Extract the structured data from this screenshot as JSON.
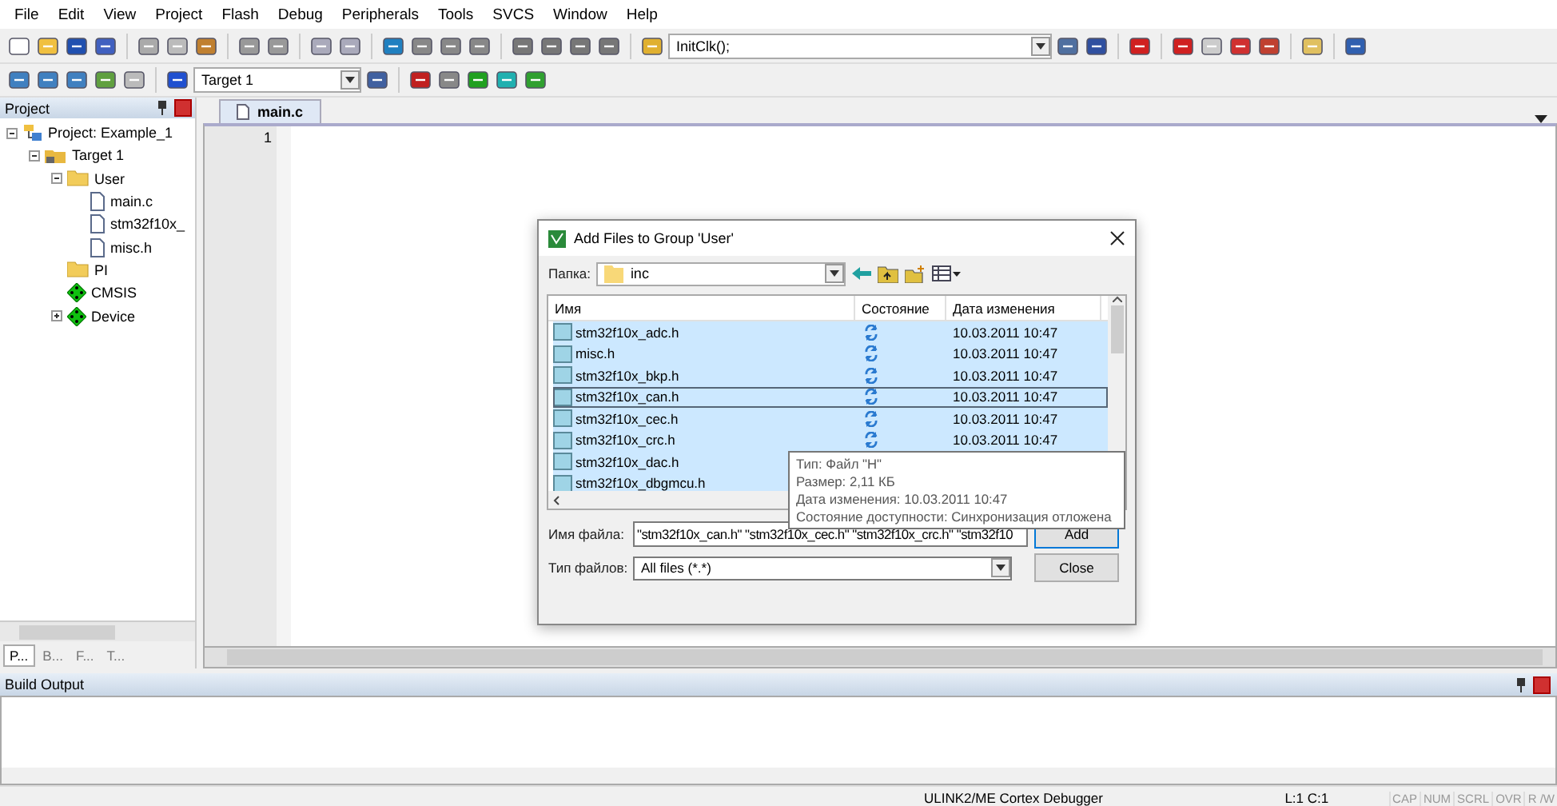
{
  "menu": [
    "File",
    "Edit",
    "View",
    "Project",
    "Flash",
    "Debug",
    "Peripherals",
    "Tools",
    "SVCS",
    "Window",
    "Help"
  ],
  "toolbar": {
    "function_combo": "InitClk();",
    "target_combo": "Target 1"
  },
  "project_panel": {
    "title": "Project",
    "tree": [
      {
        "label": "Project: Example_1",
        "kind": "project",
        "expanded": true,
        "children": [
          {
            "label": "Target 1",
            "kind": "target",
            "expanded": true,
            "children": [
              {
                "label": "User",
                "kind": "folder",
                "expanded": true,
                "children": [
                  {
                    "label": "main.c",
                    "kind": "file"
                  },
                  {
                    "label": "stm32f10x_",
                    "kind": "file"
                  },
                  {
                    "label": "misc.h",
                    "kind": "file"
                  }
                ]
              },
              {
                "label": "PI",
                "kind": "folder"
              },
              {
                "label": "CMSIS",
                "kind": "component"
              },
              {
                "label": "Device",
                "kind": "component",
                "expanded": false
              }
            ]
          }
        ]
      }
    ],
    "tabs": [
      {
        "label": "P...",
        "selected": true
      },
      {
        "label": "B...",
        "selected": false
      },
      {
        "label": "F...",
        "selected": false
      },
      {
        "label": "T...",
        "selected": false
      }
    ]
  },
  "editor": {
    "tab": "main.c",
    "line_numbers": [
      "1"
    ]
  },
  "dialog": {
    "title": "Add Files to Group 'User'",
    "folder_label": "Папка:",
    "folder": "inc",
    "columns": [
      "Имя",
      "Состояние",
      "Дата изменения"
    ],
    "rows": [
      {
        "name": "stm32f10x_adc.h",
        "sync_pending": true,
        "date": "10.03.2011 10:47",
        "selected": true,
        "focused": false
      },
      {
        "name": "misc.h",
        "sync_pending": true,
        "date": "10.03.2011 10:47",
        "selected": true,
        "focused": false
      },
      {
        "name": "stm32f10x_bkp.h",
        "sync_pending": true,
        "date": "10.03.2011 10:47",
        "selected": true,
        "focused": false
      },
      {
        "name": "stm32f10x_can.h",
        "sync_pending": true,
        "date": "10.03.2011 10:47",
        "selected": true,
        "focused": true
      },
      {
        "name": "stm32f10x_cec.h",
        "sync_pending": true,
        "date": "10.03.2011 10:47",
        "selected": true,
        "focused": false
      },
      {
        "name": "stm32f10x_crc.h",
        "sync_pending": true,
        "date": "10.03.2011 10:47",
        "selected": true,
        "focused": false
      },
      {
        "name": "stm32f10x_dac.h",
        "selected": true,
        "focused": false
      },
      {
        "name": "stm32f10x_dbgmcu.h",
        "selected": true,
        "focused": false
      }
    ],
    "tooltip": [
      "Тип: Файл \"H\"",
      "Размер: 2,11 КБ",
      "Дата изменения: 10.03.2011 10:47",
      "Состояние доступности: Синхронизация отложена"
    ],
    "filename_label": "Имя файла:",
    "filename": "\"stm32f10x_can.h\" \"stm32f10x_cec.h\" \"stm32f10x_crc.h\" \"stm32f10",
    "filetype_label": "Тип файлов:",
    "filetype": "All files (*.*)",
    "buttons": [
      "Add",
      "Close"
    ]
  },
  "build_output": {
    "title": "Build Output"
  },
  "status_bar": {
    "debugger": "ULINK2/ME Cortex Debugger",
    "position": "L:1 C:1",
    "indicators": [
      {
        "label": "CAP",
        "on": false
      },
      {
        "label": "NUM",
        "on": false
      },
      {
        "label": "SCRL",
        "on": false
      },
      {
        "label": "OVR",
        "on": false
      },
      {
        "label": "R /W",
        "on": false
      }
    ]
  }
}
